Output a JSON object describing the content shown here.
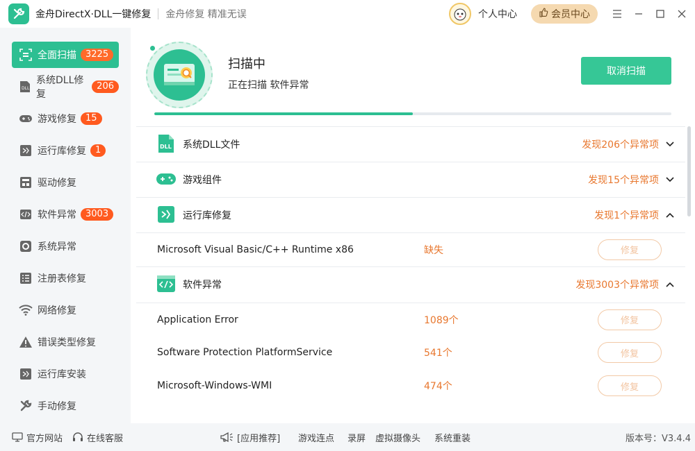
{
  "window": {
    "title": "金舟DirectX·DLL一键修复",
    "slogan": "金舟修复 精准无误",
    "user_center": "个人中心",
    "vip_center": "会员中心"
  },
  "sidebar": {
    "items": [
      {
        "label": "全面扫描",
        "badge": "3225",
        "icon": "full-scan-icon"
      },
      {
        "label": "系统DLL修复",
        "badge": "206",
        "icon": "dll-icon"
      },
      {
        "label": "游戏修复",
        "badge": "15",
        "icon": "gamepad-icon"
      },
      {
        "label": "运行库修复",
        "badge": "1",
        "icon": "runtime-icon"
      },
      {
        "label": "驱动修复",
        "badge": "",
        "icon": "driver-icon"
      },
      {
        "label": "软件异常",
        "badge": "3003",
        "icon": "code-icon"
      },
      {
        "label": "系统异常",
        "badge": "",
        "icon": "gear-icon"
      },
      {
        "label": "注册表修复",
        "badge": "",
        "icon": "registry-icon"
      },
      {
        "label": "网络修复",
        "badge": "",
        "icon": "wifi-icon"
      },
      {
        "label": "错误类型修复",
        "badge": "",
        "icon": "warning-icon"
      },
      {
        "label": "运行库安装",
        "badge": "",
        "icon": "runtime-install-icon"
      },
      {
        "label": "手动修复",
        "badge": "",
        "icon": "wrench-icon"
      }
    ]
  },
  "scan": {
    "title": "扫描中",
    "status": "正在扫描 软件异常",
    "cancel_label": "取消扫描",
    "progress": 0.5
  },
  "groups": [
    {
      "name": "系统DLL文件",
      "count": "发现206个异常项",
      "expanded": false
    },
    {
      "name": "游戏组件",
      "count": "发现15个异常项",
      "expanded": false
    },
    {
      "name": "运行库修复",
      "count": "发现1个异常项",
      "expanded": true
    },
    {
      "name": "软件异常",
      "count": "发现3003个异常项",
      "expanded": true
    }
  ],
  "runtime_items": [
    {
      "name": "Microsoft Visual Basic/C++ Runtime x86",
      "value": "缺失",
      "action": "修复"
    }
  ],
  "software_items": [
    {
      "name": "Application Error",
      "value": "1089个",
      "action": "修复"
    },
    {
      "name": "Software Protection PlatformService",
      "value": "541个",
      "action": "修复"
    },
    {
      "name": "Microsoft-Windows-WMI",
      "value": "474个",
      "action": "修复"
    }
  ],
  "footer": {
    "website": "官方网站",
    "support": "在线客服",
    "app_recommend": "[应用推荐]",
    "links": [
      "游戏连点",
      "录屏",
      "虚拟摄像头",
      "系统重装"
    ],
    "version": "版本号：V3.4.4"
  },
  "colors": {
    "accent": "#2dbf92",
    "badge": "#ff5a1f",
    "warning_text": "#e8772e"
  }
}
